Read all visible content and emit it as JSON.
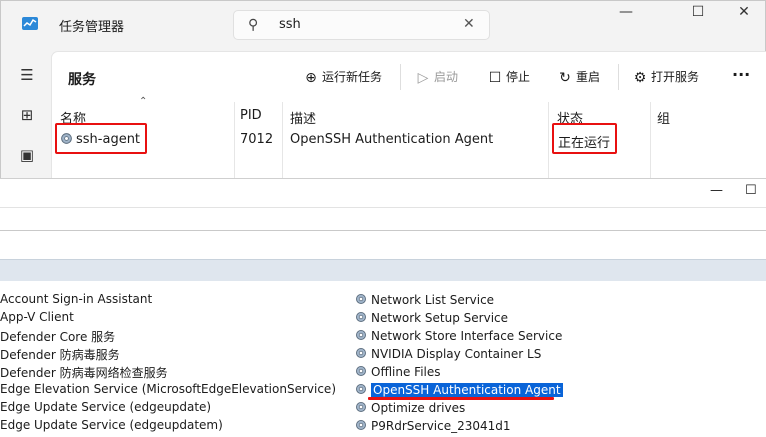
{
  "task_manager": {
    "app_title": "任务管理器",
    "search_value": "ssh",
    "page_title": "服务",
    "toolbar": {
      "new_task": "运行新任务",
      "start": "启动",
      "stop": "停止",
      "restart": "重启",
      "open_services": "打开服务",
      "more": "···"
    },
    "columns": [
      "名称",
      "PID",
      "描述",
      "状态",
      "组"
    ],
    "rows": [
      {
        "name": "ssh-agent",
        "pid": "7012",
        "description": "OpenSSH Authentication Agent",
        "status": "正在运行",
        "group": ""
      }
    ],
    "highlight_color": "#e81010"
  },
  "services_window": {
    "left_list": [
      "Account Sign-in Assistant",
      "App-V Client",
      "Defender Core 服务",
      "Defender 防病毒服务",
      "Defender 防病毒网络检查服务",
      "Edge Elevation Service (MicrosoftEdgeElevationService)",
      "Edge Update Service (edgeupdate)",
      "Edge Update Service (edgeupdatem)"
    ],
    "right_list": [
      "Network List Service",
      "Network Setup Service",
      "Network Store Interface Service",
      "NVIDIA Display Container LS",
      "Offline Files",
      "OpenSSH Authentication Agent",
      "Optimize drives",
      "P9RdrService_23041d1"
    ],
    "selected_item": "OpenSSH Authentication Agent",
    "selection_color": "#0a64d8"
  }
}
